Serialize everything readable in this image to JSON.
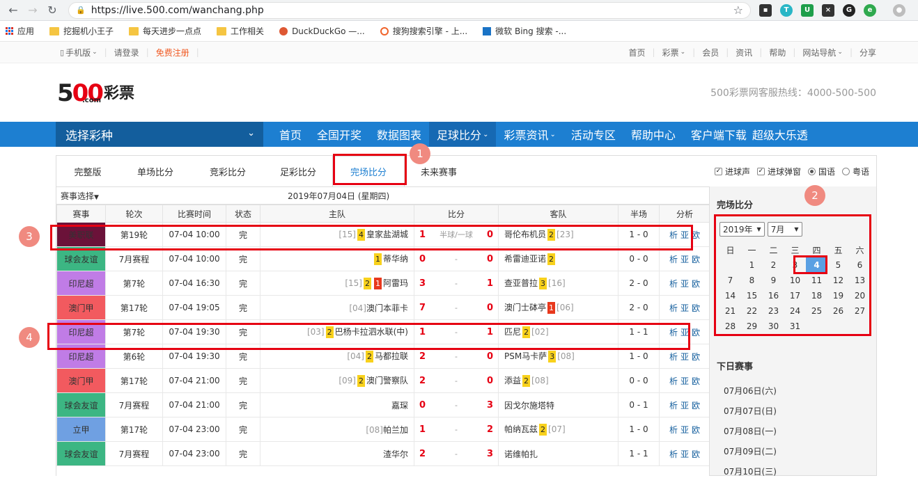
{
  "browser": {
    "url": "https://live.500.com/wanchang.php",
    "bookmarks": [
      "应用",
      "挖掘机小王子",
      "每天进步一点点",
      "工作相关",
      "DuckDuckGo —...",
      "搜狗搜索引擎 - 上...",
      "微软 Bing 搜索 -..."
    ]
  },
  "topbar": {
    "mobile": "手机版",
    "login": "请登录",
    "register": "免费注册",
    "right_links": [
      "首页",
      "彩票",
      "会员",
      "资讯",
      "帮助",
      "网站导航",
      "分享"
    ]
  },
  "header": {
    "logo_num": "500",
    "logo_text": "彩票",
    "logo_com": ".com",
    "hotline": "500彩票网客服热线：4000-500-500"
  },
  "mainnav": {
    "choose": "选择彩种",
    "items": [
      "首页",
      "全国开奖",
      "数据图表",
      "足球比分",
      "彩票资讯",
      "活动专区",
      "帮助中心",
      "客户端下载",
      "超级大乐透"
    ]
  },
  "tabs": [
    "完整版",
    "单场比分",
    "竞彩比分",
    "足彩比分",
    "完场比分",
    "未来赛事"
  ],
  "options": {
    "goal_sound": "进球声",
    "goal_popup": "进球弹窗",
    "mandarin": "国语",
    "cantonese": "粤语"
  },
  "match_select": "赛事选择",
  "date_label": "2019年07月04日 (星期四)",
  "table_headers": [
    "赛事",
    "轮次",
    "比赛时间",
    "状态",
    "主队",
    "比分",
    "客队",
    "半场",
    "分析"
  ],
  "analysis_links": [
    "析",
    "亚",
    "欧"
  ],
  "matches": [
    {
      "league": "美职联",
      "color": "#6b1239",
      "round": "第19轮",
      "time": "07-04 10:00",
      "status": "完",
      "home_rank": "[15]",
      "home_cards": [
        {
          "t": "y",
          "n": "4"
        }
      ],
      "home": "皇家盐湖城",
      "hg": "1",
      "mid": "半球/一球",
      "ag": "0",
      "away": "哥伦布机员",
      "away_cards": [
        {
          "t": "y",
          "n": "2"
        }
      ],
      "away_rank": "[23]",
      "half": "1 - 0"
    },
    {
      "league": "球会友谊",
      "color": "#3cb683",
      "round": "7月赛程",
      "time": "07-04 10:00",
      "status": "完",
      "home_rank": "",
      "home_cards": [
        {
          "t": "y",
          "n": "1"
        }
      ],
      "home": "蒂华纳",
      "hg": "0",
      "mid": "-",
      "ag": "0",
      "away": "希雷迪亚诺",
      "away_cards": [
        {
          "t": "y",
          "n": "2"
        }
      ],
      "away_rank": "",
      "half": "0 - 0"
    },
    {
      "league": "印尼超",
      "color": "#c07ce6",
      "round": "第7轮",
      "time": "07-04 16:30",
      "status": "完",
      "home_rank": "[15]",
      "home_cards": [
        {
          "t": "y",
          "n": "2"
        },
        {
          "t": "r",
          "n": "1"
        }
      ],
      "home": "阿雷玛",
      "hg": "3",
      "mid": "-",
      "ag": "1",
      "away": "查亚普拉",
      "away_cards": [
        {
          "t": "y",
          "n": "3"
        }
      ],
      "away_rank": "[16]",
      "half": "2 - 0"
    },
    {
      "league": "澳门甲",
      "color": "#f25a5f",
      "round": "第17轮",
      "time": "07-04 19:05",
      "status": "完",
      "home_rank": "[04]",
      "home_cards": [],
      "home": "澳门本菲卡",
      "hg": "7",
      "mid": "-",
      "ag": "0",
      "away": "澳门士砵亭",
      "away_cards": [
        {
          "t": "r",
          "n": "1"
        }
      ],
      "away_rank": "[06]",
      "half": "2 - 0"
    },
    {
      "league": "印尼超",
      "color": "#c07ce6",
      "round": "第7轮",
      "time": "07-04 19:30",
      "status": "完",
      "home_rank": "[03]",
      "home_cards": [
        {
          "t": "y",
          "n": "2"
        }
      ],
      "home": "巴杨卡拉泗水联(中)",
      "hg": "1",
      "mid": "-",
      "ag": "1",
      "away": "匹尼",
      "away_cards": [
        {
          "t": "y",
          "n": "2"
        }
      ],
      "away_rank": "[02]",
      "half": "1 - 1"
    },
    {
      "league": "印尼超",
      "color": "#c07ce6",
      "round": "第6轮",
      "time": "07-04 19:30",
      "status": "完",
      "home_rank": "[04]",
      "home_cards": [
        {
          "t": "y",
          "n": "2"
        }
      ],
      "home": "马都拉联",
      "hg": "2",
      "mid": "-",
      "ag": "0",
      "away": "PSM马卡萨",
      "away_cards": [
        {
          "t": "y",
          "n": "3"
        }
      ],
      "away_rank": "[08]",
      "half": "1 - 0"
    },
    {
      "league": "澳门甲",
      "color": "#f25a5f",
      "round": "第17轮",
      "time": "07-04 21:00",
      "status": "完",
      "home_rank": "[09]",
      "home_cards": [
        {
          "t": "y",
          "n": "2"
        }
      ],
      "home": "澳门警察队",
      "hg": "2",
      "mid": "-",
      "ag": "0",
      "away": "添益",
      "away_cards": [
        {
          "t": "y",
          "n": "2"
        }
      ],
      "away_rank": "[08]",
      "half": "0 - 0"
    },
    {
      "league": "球会友谊",
      "color": "#3cb683",
      "round": "7月赛程",
      "time": "07-04 21:00",
      "status": "完",
      "home_rank": "",
      "home_cards": [],
      "home": "嘉琛",
      "hg": "0",
      "mid": "-",
      "ag": "3",
      "away": "因戈尔施塔特",
      "away_cards": [],
      "away_rank": "",
      "half": "0 - 1"
    },
    {
      "league": "立甲",
      "color": "#6fa0e2",
      "round": "第17轮",
      "time": "07-04 23:00",
      "status": "完",
      "home_rank": "[08]",
      "home_cards": [],
      "home": "帕兰加",
      "hg": "1",
      "mid": "-",
      "ag": "2",
      "away": "帕纳瓦兹",
      "away_cards": [
        {
          "t": "y",
          "n": "2"
        }
      ],
      "away_rank": "[07]",
      "half": "1 - 0"
    },
    {
      "league": "球会友谊",
      "color": "#3cb683",
      "round": "7月赛程",
      "time": "07-04 23:00",
      "status": "完",
      "home_rank": "",
      "home_cards": [],
      "home": "渣华尔",
      "hg": "2",
      "mid": "-",
      "ag": "3",
      "away": "诺维帕扎",
      "away_cards": [],
      "away_rank": "",
      "half": "1 - 1"
    }
  ],
  "calendar": {
    "title": "完场比分",
    "year": "2019年",
    "month": "7月",
    "weekdays": [
      "日",
      "一",
      "二",
      "三",
      "四",
      "五",
      "六"
    ],
    "weeks": [
      [
        "",
        "1",
        "2",
        "3",
        "4",
        "5",
        "6"
      ],
      [
        "7",
        "8",
        "9",
        "10",
        "11",
        "12",
        "13"
      ],
      [
        "14",
        "15",
        "16",
        "17",
        "18",
        "19",
        "20"
      ],
      [
        "21",
        "22",
        "23",
        "24",
        "25",
        "26",
        "27"
      ],
      [
        "28",
        "29",
        "30",
        "31",
        "",
        "",
        ""
      ]
    ],
    "selected": "4"
  },
  "next_days": {
    "title": "下日赛事",
    "items": [
      "07月06日(六)",
      "07月07日(日)",
      "07月08日(一)",
      "07月09日(二)",
      "07月10日(三)"
    ]
  },
  "annotations": [
    "1",
    "2",
    "3",
    "4"
  ]
}
